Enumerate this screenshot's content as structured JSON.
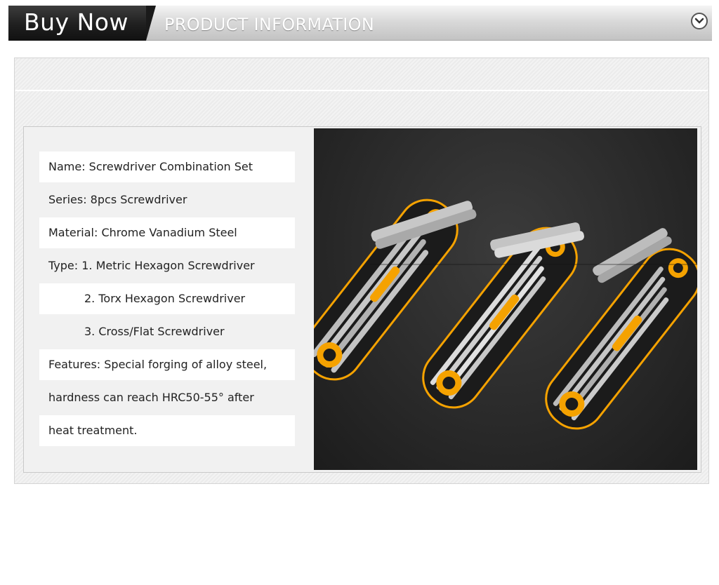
{
  "header": {
    "buy_now": "Buy Now",
    "section_title": "PRODUCT INFORMATION",
    "collapse_icon": "chevron-down-circle-icon"
  },
  "specs": [
    {
      "text": "Name: Screwdriver Combination Set"
    },
    {
      "text": "Series: 8pcs Screwdriver"
    },
    {
      "text": "Material: Chrome Vanadium Steel"
    },
    {
      "text": "Type: 1. Metric Hexagon Screwdriver"
    },
    {
      "text": "2. Torx Hexagon Screwdriver"
    },
    {
      "text": "3. Cross/Flat Screwdriver"
    },
    {
      "text": "Features: Special forging of alloy steel,"
    },
    {
      "text": "hardness can reach HRC50-55° after"
    },
    {
      "text": "heat treatment."
    }
  ],
  "photo": {
    "subject": "three folding screwdriver sets",
    "colors": {
      "accent": "#f5a200",
      "body": "#1b1b1b",
      "steel": "#b9b9b9"
    }
  }
}
